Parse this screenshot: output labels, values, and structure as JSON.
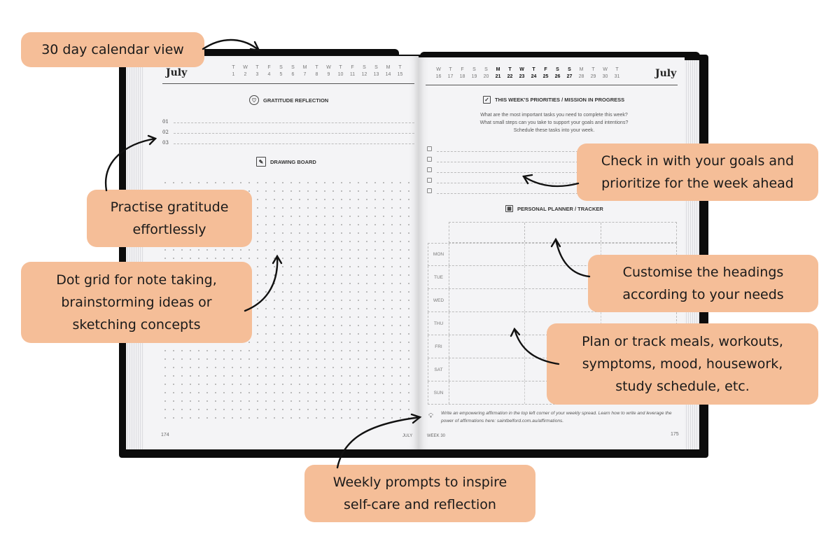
{
  "left_page": {
    "month": "July",
    "calendar": [
      {
        "dow": "T",
        "day": "1"
      },
      {
        "dow": "W",
        "day": "2"
      },
      {
        "dow": "T",
        "day": "3"
      },
      {
        "dow": "F",
        "day": "4"
      },
      {
        "dow": "S",
        "day": "5"
      },
      {
        "dow": "S",
        "day": "6"
      },
      {
        "dow": "M",
        "day": "7"
      },
      {
        "dow": "T",
        "day": "8"
      },
      {
        "dow": "W",
        "day": "9"
      },
      {
        "dow": "T",
        "day": "10"
      },
      {
        "dow": "F",
        "day": "11"
      },
      {
        "dow": "S",
        "day": "12"
      },
      {
        "dow": "S",
        "day": "13"
      },
      {
        "dow": "M",
        "day": "14"
      },
      {
        "dow": "T",
        "day": "15"
      }
    ],
    "gratitude_title": "GRATITUDE REFLECTION",
    "gratitude_lines": [
      "01",
      "02",
      "03"
    ],
    "drawing_title": "DRAWING BOARD",
    "page_number": "174",
    "footer_month": "JULY"
  },
  "right_page": {
    "month": "July",
    "calendar": [
      {
        "dow": "W",
        "day": "16",
        "bold": false
      },
      {
        "dow": "T",
        "day": "17",
        "bold": false
      },
      {
        "dow": "F",
        "day": "18",
        "bold": false
      },
      {
        "dow": "S",
        "day": "19",
        "bold": false
      },
      {
        "dow": "S",
        "day": "20",
        "bold": false
      },
      {
        "dow": "M",
        "day": "21",
        "bold": true
      },
      {
        "dow": "T",
        "day": "22",
        "bold": true
      },
      {
        "dow": "W",
        "day": "23",
        "bold": true
      },
      {
        "dow": "T",
        "day": "24",
        "bold": true
      },
      {
        "dow": "F",
        "day": "25",
        "bold": true
      },
      {
        "dow": "S",
        "day": "26",
        "bold": true
      },
      {
        "dow": "S",
        "day": "27",
        "bold": true
      },
      {
        "dow": "M",
        "day": "28",
        "bold": false
      },
      {
        "dow": "T",
        "day": "29",
        "bold": false
      },
      {
        "dow": "W",
        "day": "30",
        "bold": false
      },
      {
        "dow": "T",
        "day": "31",
        "bold": false
      }
    ],
    "priorities_title": "THIS WEEK'S PRIORITIES / MISSION IN PROGRESS",
    "priorities_prompt": [
      "What are the most important tasks you need to complete this week?",
      "What small steps can you take to support your goals and intentions?",
      "Schedule these tasks into your week."
    ],
    "checkbox_count": 5,
    "tracker_title": "PERSONAL PLANNER / TRACKER",
    "tracker_days": [
      "MON",
      "TUE",
      "WED",
      "THU",
      "FRI",
      "SAT",
      "SUN"
    ],
    "affirmation": "Write an empowering affirmation in the top left corner of your weekly spread. Learn how to write and leverage the power of affirmations here: saintbelford.com.au/affirmations.",
    "week_label": "WEEK 30",
    "page_number": "175"
  },
  "callouts": {
    "calendar": [
      "30 day calendar view"
    ],
    "gratitude": [
      "Practise gratitude",
      "effortlessly"
    ],
    "dotgrid": [
      "Dot grid for note taking,",
      "brainstorming ideas or",
      "sketching concepts"
    ],
    "goals": [
      "Check in with your goals and",
      "prioritize for the week ahead"
    ],
    "headings": [
      "Customise the headings",
      "according to your needs"
    ],
    "track": [
      "Plan or track meals, workouts,",
      "symptoms, mood, housework,",
      "study schedule, etc."
    ],
    "prompts": [
      "Weekly prompts to inspire",
      "self-care and reflection"
    ]
  },
  "colors": {
    "callout_bg": "#f5be98",
    "cover": "#0c0c0c",
    "page": "#f4f4f6"
  }
}
